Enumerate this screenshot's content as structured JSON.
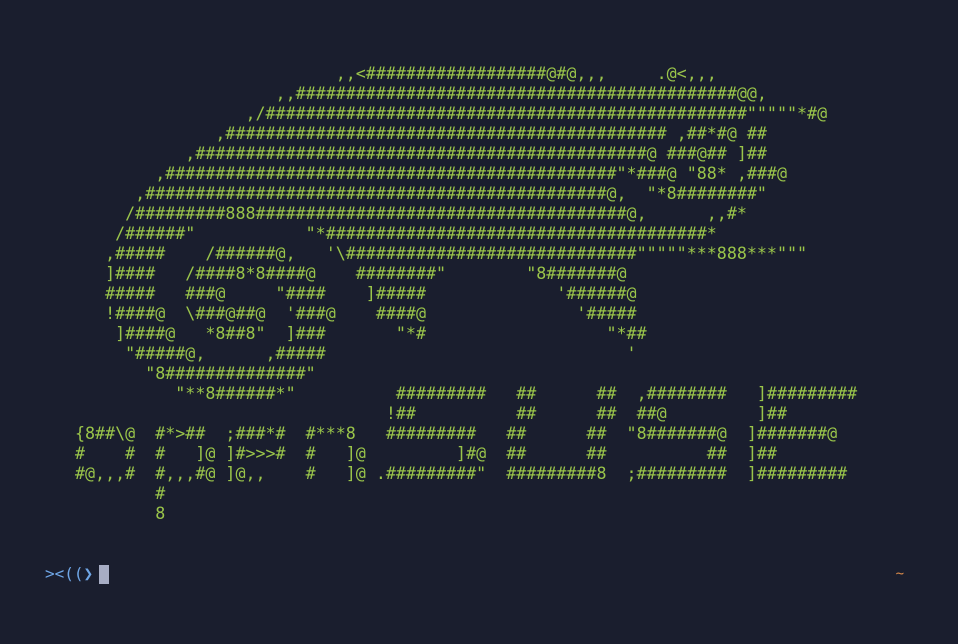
{
  "terminal": {
    "ascii_art": "                          ,,<##################@#@,,,     .@<,,,\n                    ,,############################################@@,\n                 ,/################################################\"\"\"\"\"*#@\n              ,############################################ ,##*#@ ##\n           ,#############################################@ ###@## ]##\n        ,#############################################\"*###@ \"88* ,###@\n      ,##############################################@,  \"*8########\"\n     /#########888#####################################@,      ,,#*\n    /######\"           \"*######################################*\n   ,#####    /######@,   '\\#############################\"\"\"\"\"***888***\"\"\"\n   ]####   /####8*8####@    ########\"        \"8#######@\n   #####   ###@     \"####    ]#####             '######@\n   !####@  \\###@##@  '###@    ####@               '#####\n    ]####@   *8##8\"  ]###       \"*#                  \"*##\n     \"#####@,      ,#####                              '\n       \"8##############\"\n          \"**8######*\"          #########   ##      ##  ,########   ]#########\n                               !##          ##      ##  ##@         ]##\n{8##\\@  #*>##  ;###*#  #***8   #########   ##      ##  \"8#######@  ]#######@\n#    #  #   ]@ ]#>>>#  #   ]@         ]#@  ##      ##          ##  ]##\n#@,,,#  #,,,#@ ]@,,    #   ]@ .#########\"  #########8  ;#########  ]#########\n        #\n        8",
    "prompt_symbol": "><((❯",
    "cwd": "~",
    "colors": {
      "background": "#1a1e2e",
      "art": "#9ac54a",
      "prompt": "#6fa6e6",
      "cursor": "#a7adc4",
      "cwd": "#d98a4a"
    }
  }
}
